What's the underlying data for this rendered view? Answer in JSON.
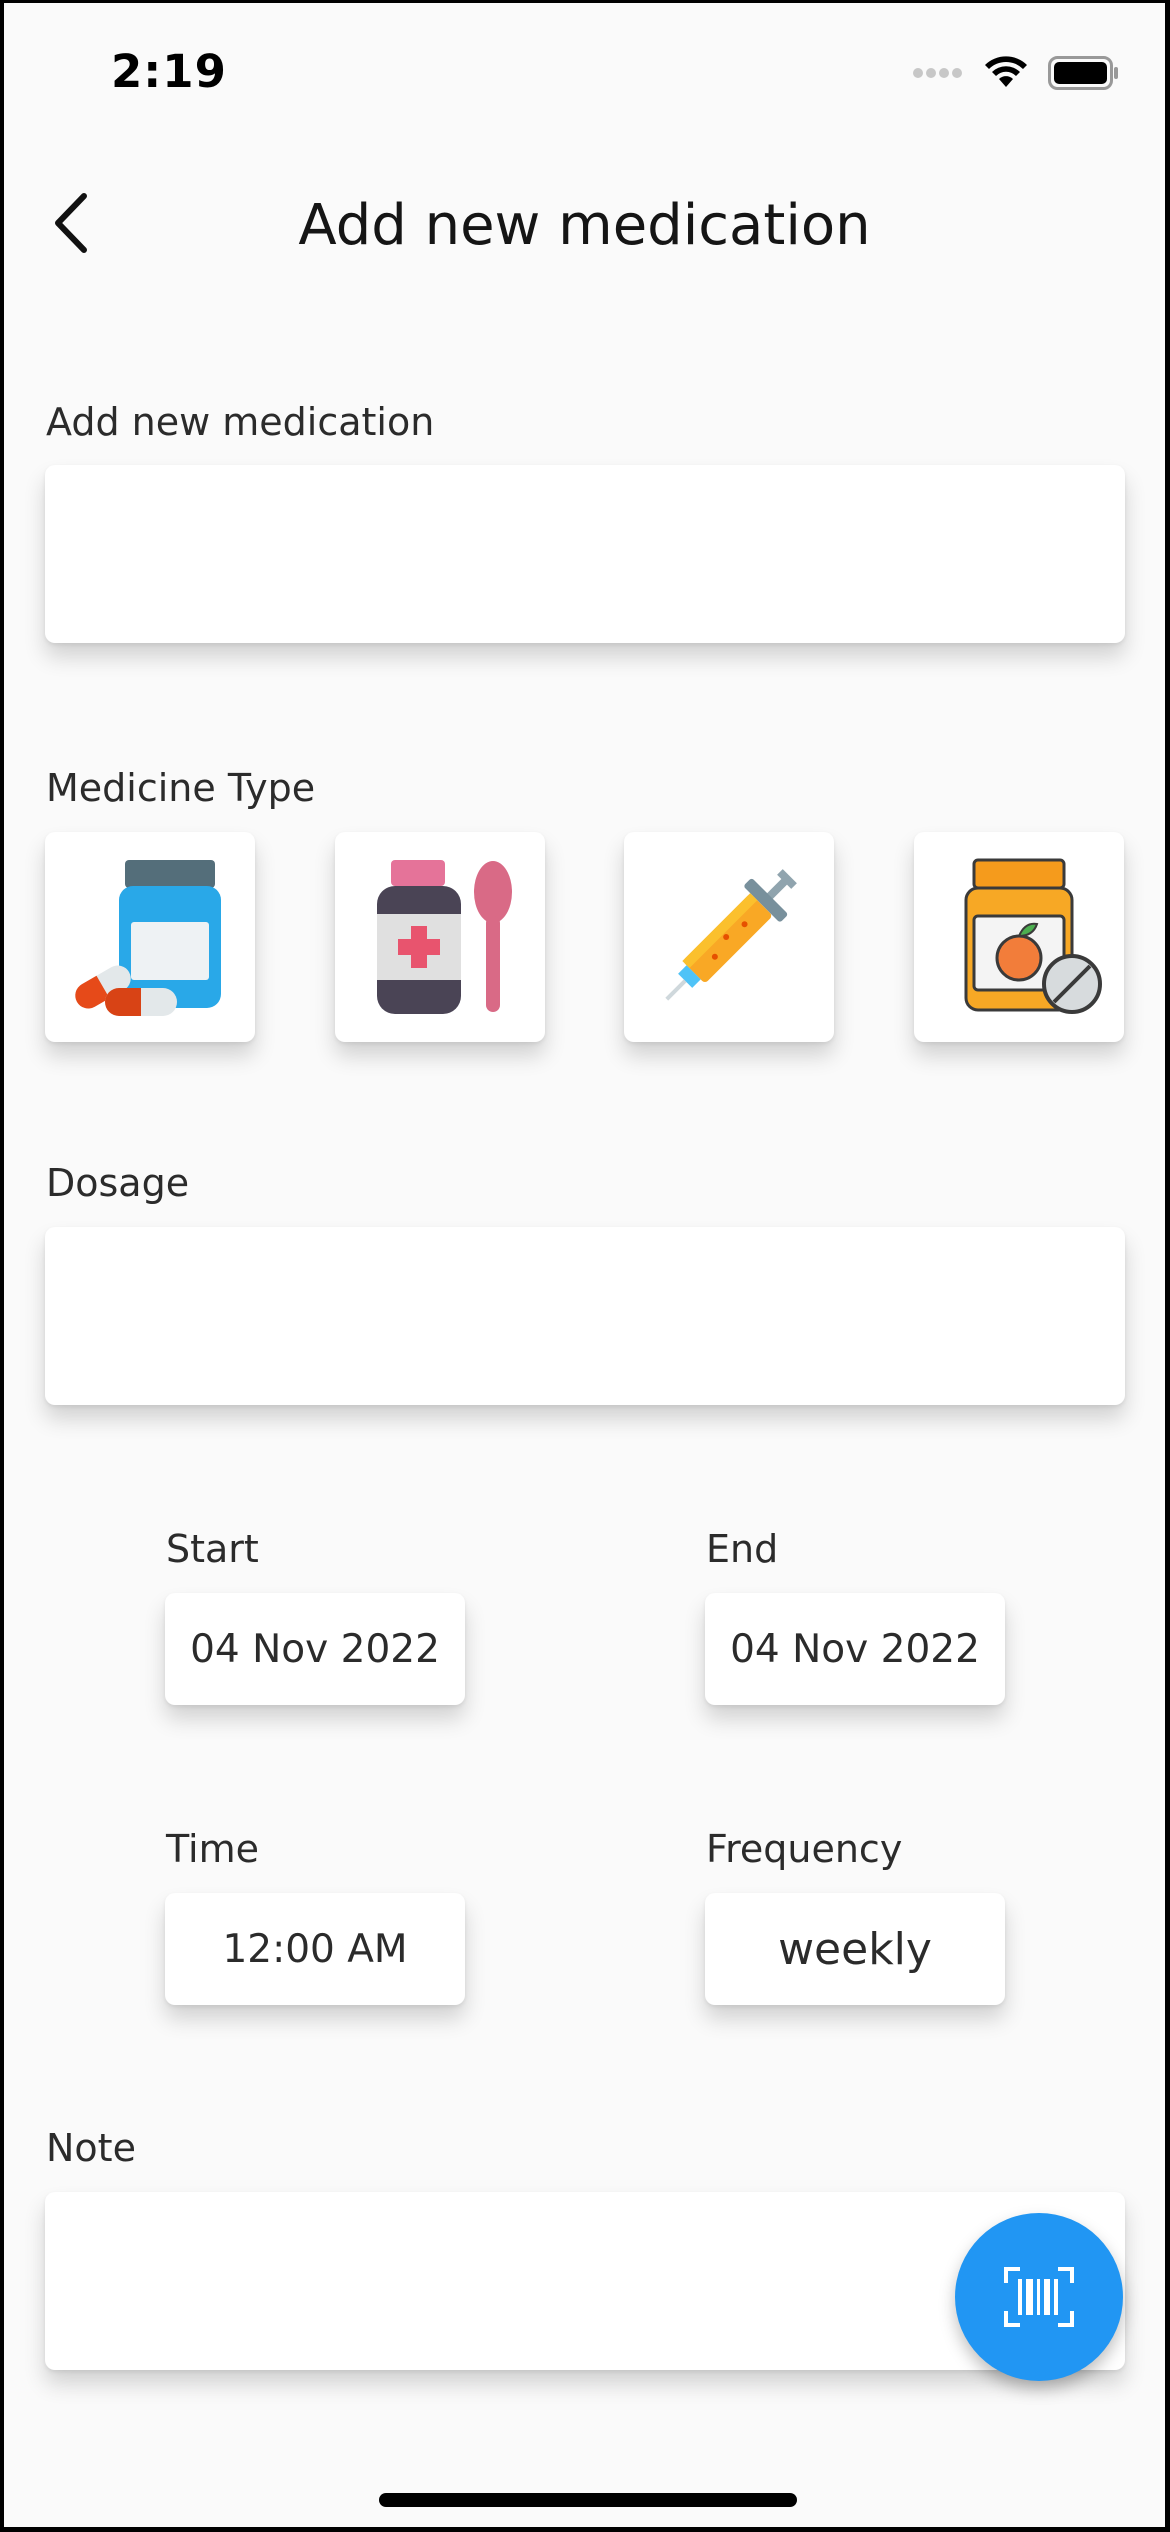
{
  "status_bar": {
    "time": "2:19"
  },
  "header": {
    "title": "Add new medication",
    "back_icon": "chevron-left-icon"
  },
  "form": {
    "name_label": "Add new medication",
    "name_value": "",
    "medicine_type_label": "Medicine Type",
    "medicine_types": [
      {
        "icon": "pill-bottle-icon"
      },
      {
        "icon": "syrup-bottle-spoon-icon"
      },
      {
        "icon": "syringe-icon"
      },
      {
        "icon": "vitamin-jar-icon"
      }
    ],
    "dosage_label": "Dosage",
    "dosage_value": "",
    "start_label": "Start",
    "start_value": "04 Nov 2022",
    "end_label": "End",
    "end_value": "04 Nov 2022",
    "time_label": "Time",
    "time_value": "12:00 AM",
    "frequency_label": "Frequency",
    "frequency_value": "weekly",
    "note_label": "Note",
    "note_value": ""
  },
  "fab": {
    "icon": "barcode-scan-icon"
  },
  "colors": {
    "accent": "#2196f3",
    "background": "#fafafa"
  }
}
